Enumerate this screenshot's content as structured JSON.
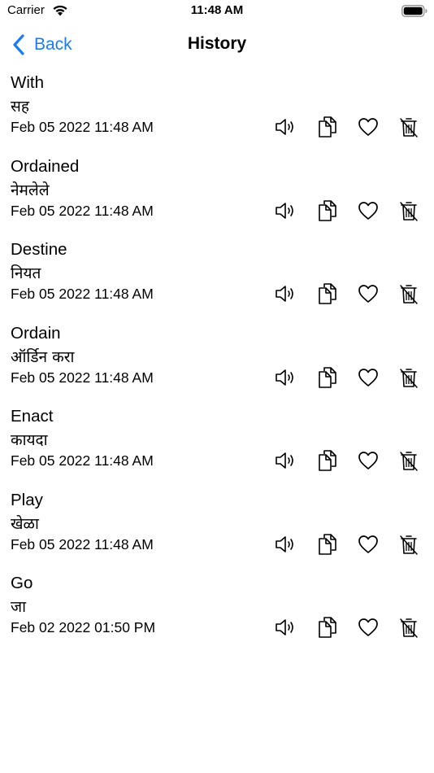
{
  "status_bar": {
    "carrier": "Carrier",
    "time": "11:48 AM"
  },
  "nav": {
    "back_label": "Back",
    "title": "History"
  },
  "history": [
    {
      "word": "With",
      "translation": "सह",
      "date": "Feb 05 2022 11:48 AM"
    },
    {
      "word": "Ordained",
      "translation": "नेमलेले",
      "date": "Feb 05 2022 11:48 AM"
    },
    {
      "word": "Destine",
      "translation": "नियत",
      "date": "Feb 05 2022 11:48 AM"
    },
    {
      "word": "Ordain",
      "translation": "ऑर्डिन करा",
      "date": "Feb 05 2022 11:48 AM"
    },
    {
      "word": "Enact",
      "translation": "कायदा",
      "date": "Feb 05 2022 11:48 AM"
    },
    {
      "word": "Play",
      "translation": "खेळा",
      "date": "Feb 05 2022 11:48 AM"
    },
    {
      "word": "Go",
      "translation": "जा",
      "date": "Feb 02 2022 01:50 PM"
    }
  ],
  "icons": {
    "speak": "speaker-icon",
    "copy": "copy-icon",
    "favorite": "heart-icon",
    "delete": "trash-icon"
  },
  "colors": {
    "accent": "#1a7cf5",
    "text": "#000000",
    "background": "#ffffff"
  }
}
